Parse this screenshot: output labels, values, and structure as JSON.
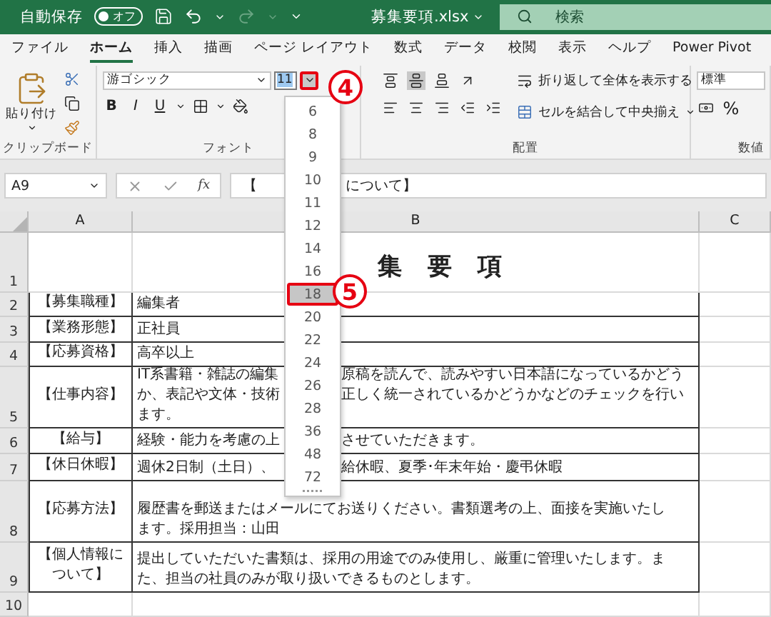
{
  "titlebar": {
    "autosave_label": "自動保存",
    "autosave_toggle": {
      "label": "オフ",
      "on": false
    },
    "filename": "募集要項.xlsx",
    "search": {
      "placeholder": "検索"
    }
  },
  "tabs": [
    {
      "label": "ファイル",
      "selected": false
    },
    {
      "label": "ホーム",
      "selected": true
    },
    {
      "label": "挿入",
      "selected": false
    },
    {
      "label": "描画",
      "selected": false
    },
    {
      "label": "ページ レイアウト",
      "selected": false
    },
    {
      "label": "数式",
      "selected": false
    },
    {
      "label": "データ",
      "selected": false
    },
    {
      "label": "校閲",
      "selected": false
    },
    {
      "label": "表示",
      "selected": false
    },
    {
      "label": "ヘルプ",
      "selected": false
    },
    {
      "label": "Power Pivot",
      "selected": false
    }
  ],
  "ribbon": {
    "clipboard": {
      "paste_label": "貼り付け",
      "group_label": "クリップボード"
    },
    "font": {
      "font_name": "游ゴシック",
      "font_size": "11",
      "bold": "B",
      "italic": "I",
      "underline": "U",
      "group_label": "フォント"
    },
    "alignment": {
      "wrap_text": "折り返して全体を表示する",
      "merge_center": "セルを結合して中央揃え",
      "group_label": "配置"
    },
    "number": {
      "format": "標準",
      "percent": "%",
      "group_label": "数値"
    }
  },
  "formula_bar": {
    "name_box": "A9",
    "fx": "fx",
    "content": [
      "【",
      "について】"
    ]
  },
  "sheet": {
    "columns": [
      "A",
      "B",
      "C"
    ],
    "rows": [
      {
        "number": "1",
        "kind": "title",
        "lines": [
          [
            "集 要 項"
          ]
        ]
      },
      {
        "number": "2",
        "kind": "entry",
        "label": "【募集職種】",
        "lines": [
          [
            "編集者"
          ]
        ]
      },
      {
        "number": "3",
        "kind": "entry",
        "label": "【業務形態】",
        "lines": [
          [
            "正社員"
          ]
        ]
      },
      {
        "number": "4",
        "kind": "entry",
        "label": "【応募資格】",
        "lines": [
          [
            "高卒以上"
          ]
        ]
      },
      {
        "number": "5",
        "kind": "entry",
        "label": "【仕事内容】",
        "lines": [
          [
            "IT系書籍・雑誌の編集",
            "原稿を読んで、読みやすい日本語になっているかどう"
          ],
          [
            "か、表記や文体・技術",
            "正しく統一されているかどうかなどのチェックを行い"
          ],
          [
            "ます。"
          ]
        ]
      },
      {
        "number": "6",
        "kind": "entry",
        "label": "【給与】",
        "lines": [
          [
            "経験・能力を考慮の上",
            "させていただきます。"
          ]
        ]
      },
      {
        "number": "7",
        "kind": "entry",
        "label": "【休日休暇】",
        "lines": [
          [
            "週休2日制（土日）、",
            "給休暇、夏季･年末年始・慶弔休暇"
          ]
        ]
      },
      {
        "number": "8",
        "kind": "entry",
        "label": "【応募方法】",
        "lines": [
          [
            "履歴書を郵送またはメールにてお送りください。書類選考の上、面接を実施いたし"
          ],
          [
            "ます。採用担当：山田"
          ]
        ]
      },
      {
        "number": "9",
        "kind": "entry",
        "label": "【個人情報について】",
        "lines": [
          [
            "提出していただいた書類は、採用の用途でのみ使用し、厳重に管理いたします。ま"
          ],
          [
            "た、担当の社員のみが取り扱いできるものとします。"
          ]
        ]
      },
      {
        "number": "10",
        "kind": "blank"
      }
    ]
  },
  "font_size_dropdown": {
    "items": [
      {
        "label": "6",
        "selected": false
      },
      {
        "label": "8",
        "selected": false
      },
      {
        "label": "9",
        "selected": false
      },
      {
        "label": "10",
        "selected": false
      },
      {
        "label": "11",
        "selected": false
      },
      {
        "label": "12",
        "selected": false
      },
      {
        "label": "14",
        "selected": false
      },
      {
        "label": "16",
        "selected": false
      },
      {
        "label": "18",
        "selected": true
      },
      {
        "label": "20",
        "selected": false
      },
      {
        "label": "22",
        "selected": false
      },
      {
        "label": "24",
        "selected": false
      },
      {
        "label": "26",
        "selected": false
      },
      {
        "label": "28",
        "selected": false
      },
      {
        "label": "36",
        "selected": false
      },
      {
        "label": "48",
        "selected": false
      },
      {
        "label": "72",
        "selected": false
      }
    ]
  },
  "annotations": [
    {
      "label": "4"
    },
    {
      "label": "5"
    }
  ]
}
